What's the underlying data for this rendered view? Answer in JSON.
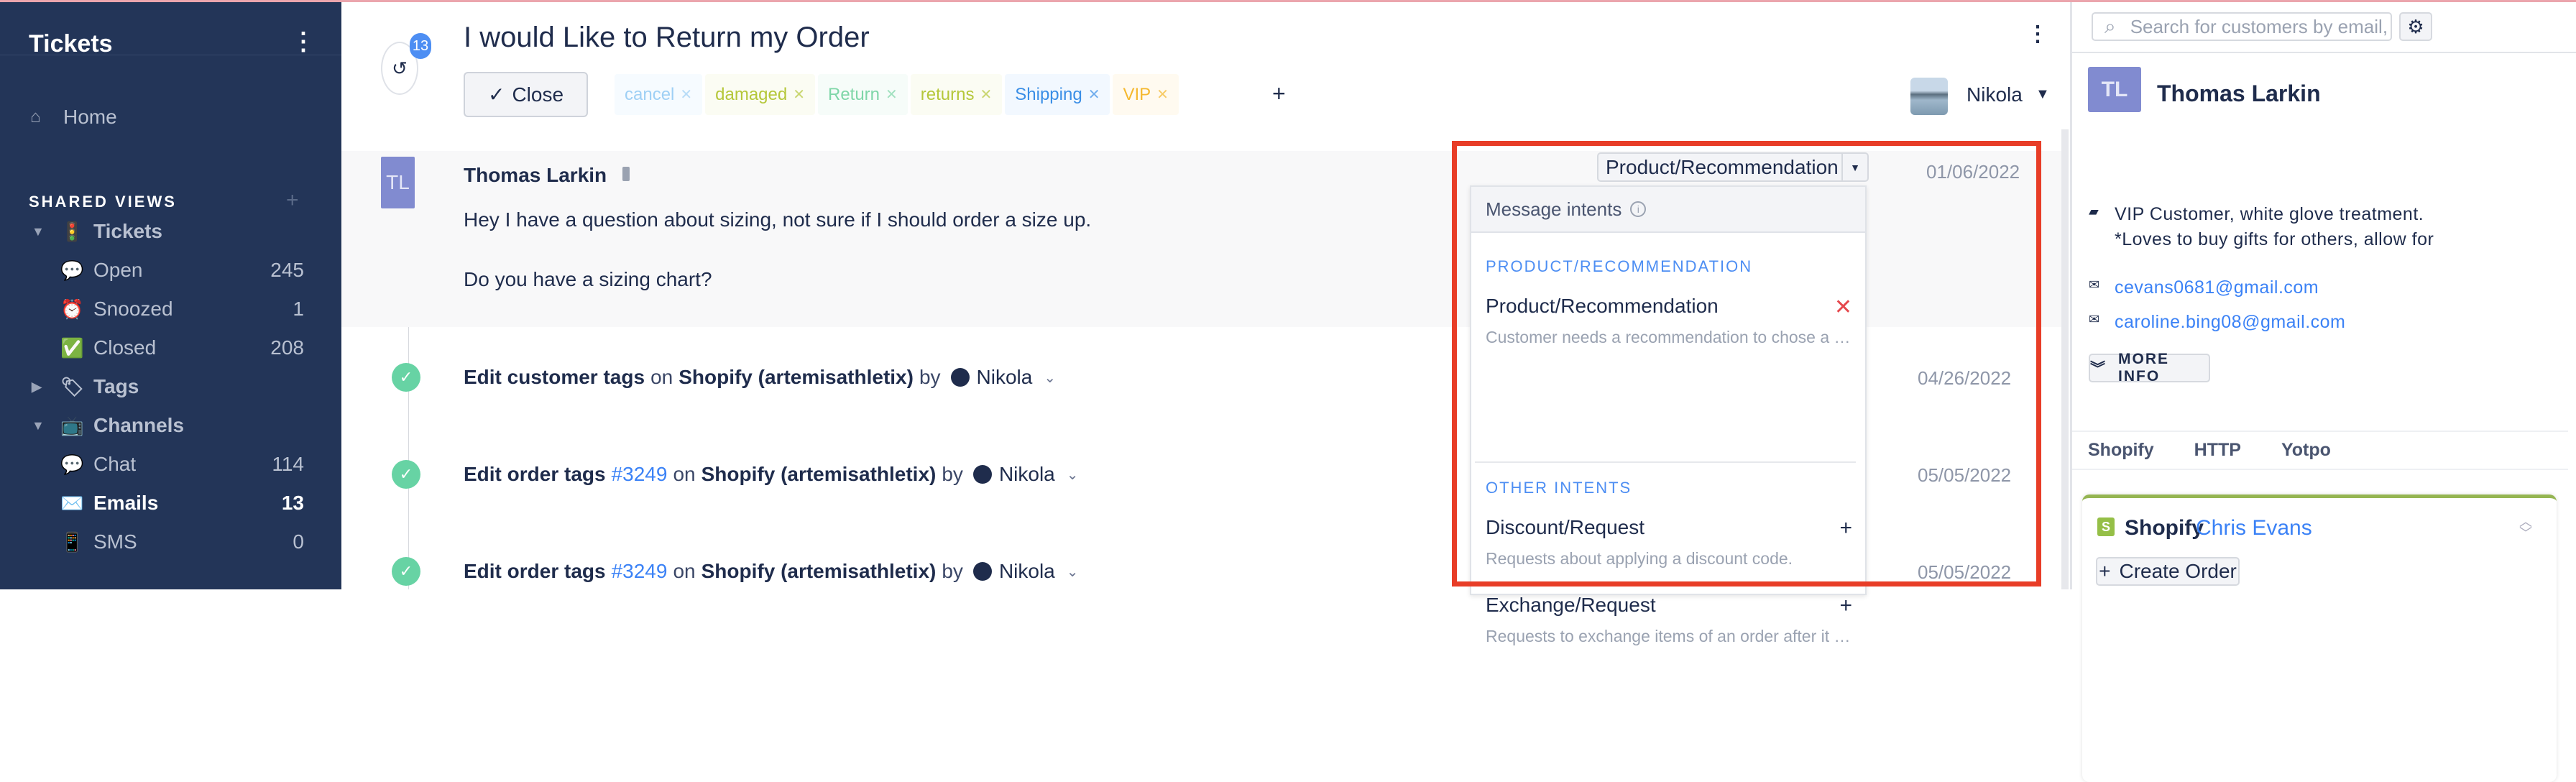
{
  "sidebar": {
    "title": "Tickets",
    "home": "Home",
    "shared_views_label": "SHARED VIEWS",
    "items": [
      {
        "label": "Tickets",
        "icon": "traffic-light-icon",
        "emoji": "🚦",
        "group": true,
        "expanded": true
      },
      {
        "label": "Open",
        "icon": "speech-bubble-icon",
        "emoji": "💬",
        "count": "245"
      },
      {
        "label": "Snoozed",
        "icon": "alarm-clock-icon",
        "emoji": "⏰",
        "count": "1"
      },
      {
        "label": "Closed",
        "icon": "check-box-icon",
        "emoji": "✅",
        "count": "208"
      },
      {
        "label": "Tags",
        "icon": "tag-icon",
        "emoji": "🏷",
        "group": true,
        "expanded": false
      },
      {
        "label": "Channels",
        "icon": "tv-icon",
        "emoji": "📺",
        "group": true,
        "expanded": true
      },
      {
        "label": "Chat",
        "icon": "speech-bubble-icon",
        "emoji": "💬",
        "count": "114"
      },
      {
        "label": "Emails",
        "icon": "envelope-icon",
        "emoji": "✉️",
        "count": "13",
        "active": true
      },
      {
        "label": "SMS",
        "icon": "mobile-phone-icon",
        "emoji": "📱",
        "count": "0"
      }
    ]
  },
  "ticket": {
    "history_count": "13",
    "title": "I would Like to Return my Order",
    "close_label": "Close",
    "tags": [
      {
        "label": "cancel",
        "color": "#9fd0f5",
        "bg": "#f6fbff"
      },
      {
        "label": "damaged",
        "color": "#b5c73a",
        "bg": "#fbfcf3"
      },
      {
        "label": "Return",
        "color": "#7fd6a8",
        "bg": "#f6fcf9"
      },
      {
        "label": "returns",
        "color": "#b5c73a",
        "bg": "#fbfcf3"
      },
      {
        "label": "Shipping",
        "color": "#3a8ee6",
        "bg": "#f2f8ff"
      },
      {
        "label": "VIP",
        "color": "#f5b82e",
        "bg": "#fffaf0"
      }
    ],
    "assignee": "Nikola"
  },
  "message": {
    "initials": "TL",
    "sender": "Thomas Larkin",
    "lines": [
      "Hey I have a question about sizing, not sure if I should order a size up.",
      "Do you have a sizing chart?"
    ],
    "intent": "Product/Recommendation",
    "date": "01/06/2022"
  },
  "events": [
    {
      "action": "Edit customer tags",
      "ref": "",
      "on": "on",
      "target": "Shopify (artemisathletix)",
      "by": "by",
      "user": "Nikola",
      "date": "04/26/2022"
    },
    {
      "action": "Edit order tags",
      "ref": "#3249",
      "on": "on",
      "target": "Shopify (artemisathletix)",
      "by": "by",
      "user": "Nikola",
      "date": "05/05/2022"
    },
    {
      "action": "Edit order tags",
      "ref": "#3249",
      "on": "on",
      "target": "Shopify (artemisathletix)",
      "by": "by",
      "user": "Nikola",
      "date": "05/05/2022"
    }
  ],
  "intents_menu": {
    "header": "Message intents",
    "current_section": "PRODUCT/RECOMMENDATION",
    "current": {
      "name": "Product/Recommendation",
      "desc": "Customer needs a recommendation to chose a product"
    },
    "other_section": "OTHER INTENTS",
    "others": [
      {
        "name": "Discount/Request",
        "desc": "Requests about applying a discount code."
      },
      {
        "name": "Exchange/Request",
        "desc": "Requests to exchange items of an order after it was received"
      }
    ]
  },
  "customer": {
    "search_placeholder": "Search for customers by email, order",
    "initials": "TL",
    "name": "Thomas Larkin",
    "note_line1": "VIP Customer, white glove treatment.",
    "note_line2": "*Loves to buy gifts for others, allow for",
    "emails": [
      "cevans0681@gmail.com",
      "caroline.bing08@gmail.com"
    ],
    "more_info": "MORE INFO",
    "tabs": [
      "Shopify",
      "HTTP",
      "Yotpo"
    ],
    "shopify_title": "Shopify",
    "shopify_customer": "Chris Evans",
    "create_order": "Create Order"
  },
  "colors": {
    "sidebar_bg": "#233558",
    "accent": "#3b82f6",
    "highlight_box": "#e83d27",
    "success": "#67d3a4"
  }
}
